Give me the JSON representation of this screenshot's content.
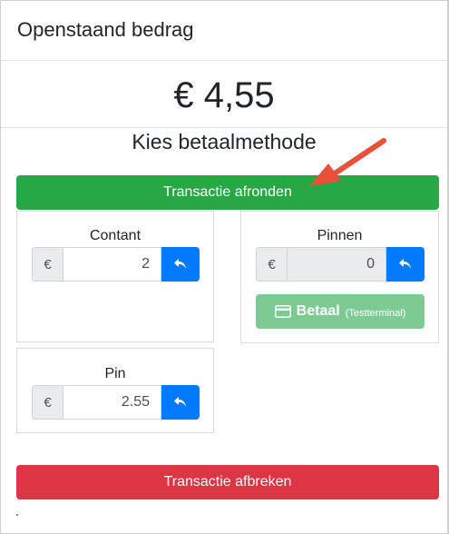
{
  "header": {
    "title": "Openstaand bedrag"
  },
  "amount": "€ 4,55",
  "method_title": "Kies betaalmethode",
  "complete_button": "Transactie afronden",
  "contant": {
    "label": "Contant",
    "currency": "€",
    "value": "2"
  },
  "pinnen": {
    "label": "Pinnen",
    "currency": "€",
    "value": "0",
    "pay_button": {
      "label": "Betaal",
      "sub": "(Testterminal)"
    }
  },
  "pin": {
    "label": "Pin",
    "currency": "€",
    "value": "2.55"
  },
  "abort_button": "Transactie afbreken",
  "colors": {
    "success": "#28a745",
    "danger": "#dc3545",
    "primary": "#007bff",
    "annotation_arrow": "#e8503a"
  },
  "icons": {
    "undo": "undo-arrow-icon",
    "card": "credit-card-icon"
  }
}
